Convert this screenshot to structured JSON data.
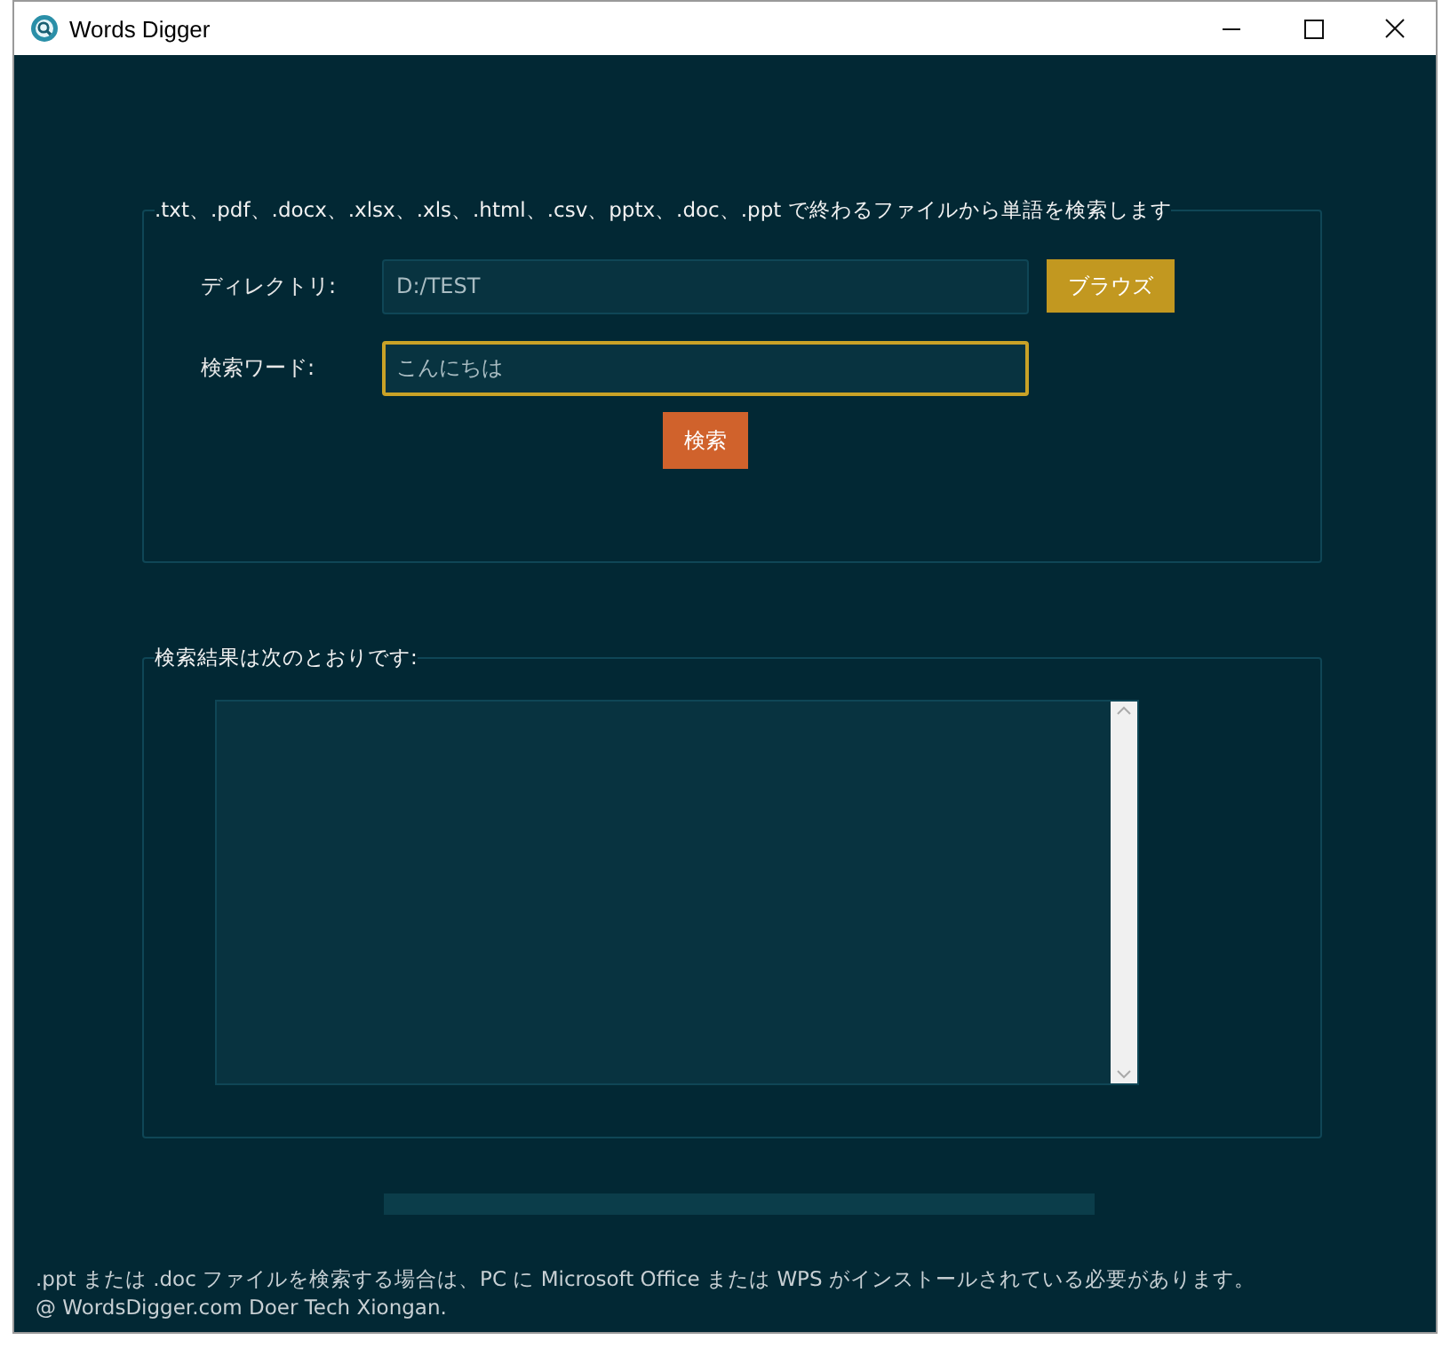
{
  "window": {
    "title": "Words Digger"
  },
  "search_panel": {
    "legend": ".txt、.pdf、.docx、.xlsx、.xls、.html、.csv、pptx、.doc、.ppt で終わるファイルから単語を検索します",
    "directory": {
      "label": "ディレクトリ:",
      "value": "D:/TEST",
      "focused": false
    },
    "browse_button": "ブラウズ",
    "keyword": {
      "label": "検索ワード:",
      "value": "こんにちは",
      "focused": true
    },
    "search_button": "検索"
  },
  "results_panel": {
    "legend": "検索結果は次のとおりです:"
  },
  "progress": {
    "level": 0
  },
  "footer": [
    ".ppt または .doc ファイルを検索する場合は、PC に Microsoft Office または WPS がインストールされている必要があります。",
    "@ WordsDigger.com Doer Tech Xiongan."
  ]
}
